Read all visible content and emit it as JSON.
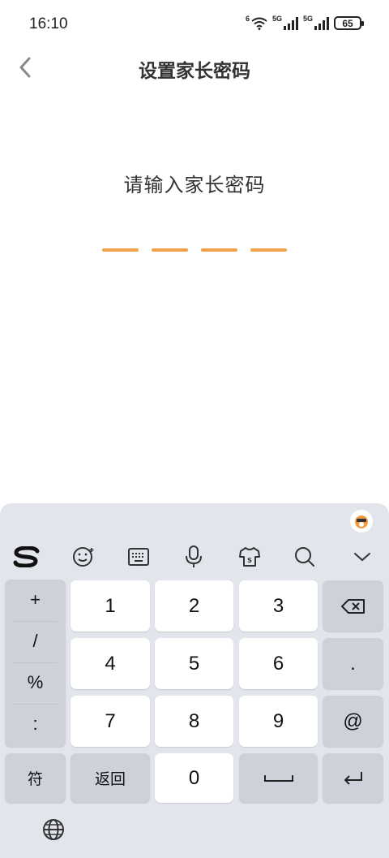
{
  "status_bar": {
    "time": "16:10",
    "wifi_label": "6",
    "net1_label": "5G",
    "net2_label": "5G",
    "battery": "65"
  },
  "header": {
    "title": "设置家长密码",
    "back_icon": "chevron-left-icon"
  },
  "password": {
    "prompt": "请输入家长密码",
    "slot_count": 4,
    "slot_color": "#f0a14a"
  },
  "keyboard": {
    "toolbar": [
      "sogou-logo-icon",
      "emoji-icon",
      "keyboard-icon",
      "mic-icon",
      "skin-icon",
      "search-icon",
      "collapse-icon"
    ],
    "symbols": [
      "+",
      "/",
      "%",
      ":"
    ],
    "digits": [
      "1",
      "2",
      "3",
      "4",
      "5",
      "6",
      "7",
      "8",
      "9",
      "0"
    ],
    "dot": ".",
    "at": "@",
    "fu_label": "符",
    "back_label": "返回",
    "space_icon": "space-icon",
    "enter_icon": "enter-icon",
    "delete_icon": "backspace-icon",
    "globe_icon": "globe-icon"
  }
}
